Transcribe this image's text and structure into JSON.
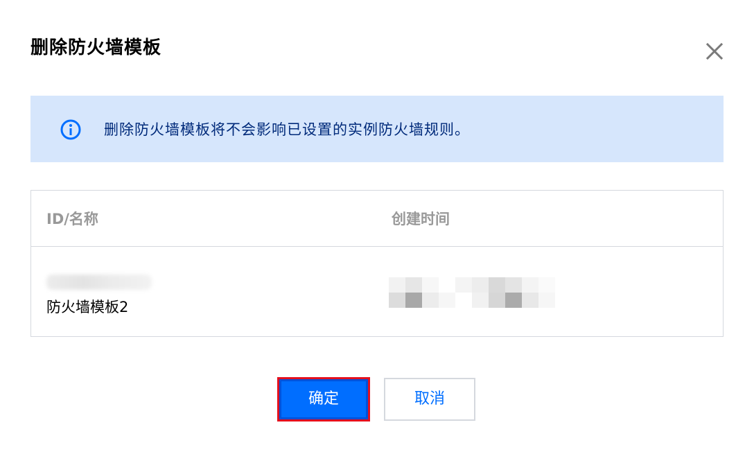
{
  "dialog": {
    "title": "删除防火墙模板",
    "close_icon": "close-icon"
  },
  "alert": {
    "icon": "info-icon",
    "text": "删除防火墙模板将不会影响已设置的实例防火墙规则。",
    "background_color": "#d6e6fc",
    "text_color": "#002a7a"
  },
  "table": {
    "columns": [
      "ID/名称",
      "创建时间"
    ],
    "rows": [
      {
        "id": "",
        "name": "防火墙模板2",
        "created_time": ""
      }
    ]
  },
  "buttons": {
    "confirm_label": "确定",
    "cancel_label": "取消"
  },
  "colors": {
    "primary": "#006eff",
    "highlight_border": "#e3101e",
    "border": "#d5d8de"
  }
}
